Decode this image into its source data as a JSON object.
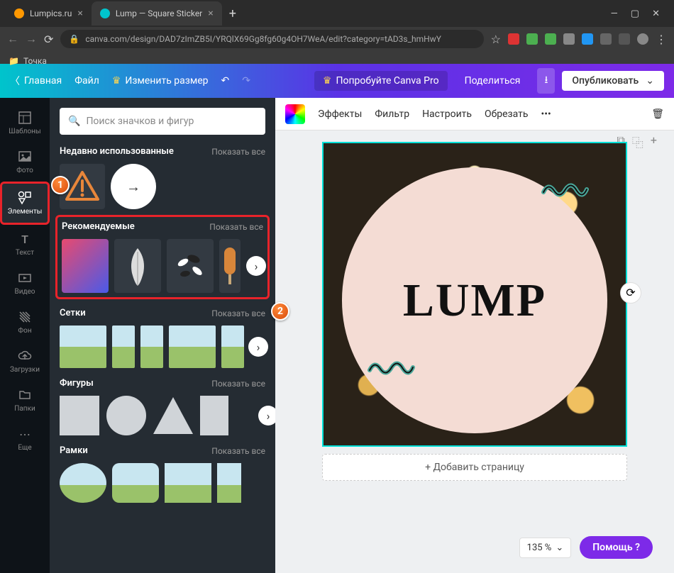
{
  "browser": {
    "tabs": [
      {
        "title": "Lumpics.ru"
      },
      {
        "title": "Lump — Square Sticker"
      }
    ],
    "url": "canva.com/design/DAD7zImZB5I/YRQlX69Gg8fg60g4OH7WeA/edit?category=tAD3s_hmHwY",
    "bookmark_folder": "Точка"
  },
  "app_bar": {
    "home": "Главная",
    "file": "Файл",
    "resize": "Изменить размер",
    "try_pro": "Попробуйте Canva Pro",
    "share": "Поделиться",
    "publish": "Опубликовать"
  },
  "side_nav": {
    "templates": "Шаблоны",
    "photos": "Фото",
    "elements": "Элементы",
    "text": "Текст",
    "video": "Видео",
    "background": "Фон",
    "uploads": "Загрузки",
    "folders": "Папки",
    "more": "Еще"
  },
  "panel": {
    "search_placeholder": "Поиск значков и фигур",
    "recent": {
      "title": "Недавно использованные",
      "show_all": "Показать все"
    },
    "recommended": {
      "title": "Рекомендуемые",
      "show_all": "Показать все"
    },
    "grids": {
      "title": "Сетки",
      "show_all": "Показать все"
    },
    "shapes": {
      "title": "Фигуры",
      "show_all": "Показать все"
    },
    "frames": {
      "title": "Рамки",
      "show_all": "Показать все"
    }
  },
  "context_toolbar": {
    "effects": "Эффекты",
    "filter": "Фильтр",
    "adjust": "Настроить",
    "crop": "Обрезать",
    "more": "•••"
  },
  "canvas": {
    "sticker_text": "LUMP",
    "add_page": "+ Добавить страницу"
  },
  "bottom": {
    "zoom": "135 %",
    "help": "Помощь ?"
  },
  "annotations": {
    "b1": "1",
    "b2": "2"
  }
}
